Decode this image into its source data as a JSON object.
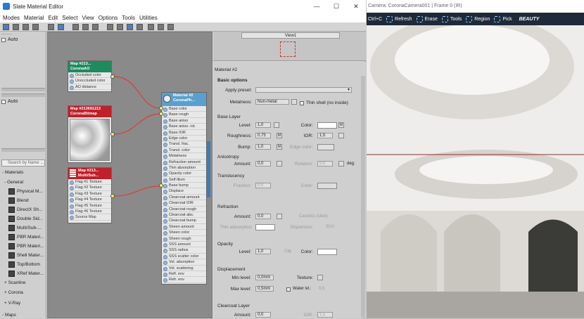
{
  "editor": {
    "title": "Slate Material Editor",
    "window_controls": [
      "—",
      "☐",
      "✕"
    ],
    "menu": [
      "Modes",
      "Material",
      "Edit",
      "Select",
      "View",
      "Options",
      "Tools",
      "Utilities"
    ]
  },
  "left_panel": {
    "auto_label_1": "Auto",
    "auto_label_2": "Auto",
    "search_placeholder": "Search by Name ...",
    "materials_header": "- Materials",
    "general_header": "- General",
    "materials": [
      "Physical M...",
      "Blend",
      "DirectX Sh...",
      "Double Sid...",
      "Multi/Sub-...",
      "PBR Materi...",
      "PBR Materi...",
      "Shell Mater...",
      "Top/Bottom",
      "XRef Mater..."
    ],
    "scanline": "+ Scanline",
    "corona": "+ Corona",
    "vray": "+ V-Ray",
    "maps": "- Maps"
  },
  "view": {
    "tab": "View1",
    "node_ao": {
      "title": "Map #213...",
      "subtitle": "CoronaAO",
      "rows": [
        "Occluded color",
        "Unoccluded color",
        "AO distance"
      ]
    },
    "node_bitmap": {
      "title": "Map #213691213",
      "subtitle": "CoronaBitmap"
    },
    "node_multi": {
      "title": "Map #213...",
      "subtitle": "Multi/Sub...",
      "rows": [
        "Flag #1 Texture",
        "Flag #2 Texture",
        "Flag #3 Texture",
        "Flag #4 Texture",
        "Flag #5 Texture",
        "Flag #6 Texture",
        "Source Map"
      ]
    },
    "node_material": {
      "title": "Material #2",
      "subtitle": "CoronaPh...",
      "rows": [
        "Base color",
        "Base rough",
        "Base aniso",
        "Base aniso. rot.",
        "Base IOR",
        "Edge color",
        "Transl. frac.",
        "Transl. color",
        "Metalness",
        "Refraction amount",
        "Thin absorption",
        "Opacity color",
        "Self-Illum",
        "Base bump",
        "Displace",
        "Clearcoat amount",
        "Clearcoat IOR",
        "Clearcoat rough",
        "Clearcoat abs.",
        "Clearcoat bump",
        "Sheen amount",
        "Sheen color",
        "Sheen rough",
        "SSS amount",
        "SSS radius",
        "SSS scatter color",
        "Vol. absorption",
        "Vol. scattering",
        "Refl. env",
        "Refr. env"
      ]
    }
  },
  "params": {
    "header": "Material #2",
    "basic_options": "Basic options",
    "apply_preset": "Apply preset:",
    "metalness_label": "Metalness:",
    "metalness_value": "Non-metal",
    "thin_shell": "Thin shell (no inside)",
    "base_layer": "Base Layer",
    "level_label": "Level:",
    "level_value": "1,0",
    "color_label": "Color:",
    "roughness_label": "Roughness:",
    "roughness_value": "0,75",
    "ior_label": "IOR:",
    "ior_value": "1,5",
    "bump_label": "Bump:",
    "bump_value": "1,0",
    "edge_color": "Edge color:",
    "anisotropy": "Anisotropy",
    "amount_label": "Amount:",
    "aniso_amount": "0,0",
    "rotation_label": "Rotation:",
    "rotation_value": "0,0",
    "deg": "deg.",
    "translucency": "Translucency",
    "fraction_label": "Fraction:",
    "fraction_value": "0,0",
    "refraction": "Refraction",
    "refr_amount": "0,0",
    "caustics": "Caustics (slow)",
    "thin_absorption": "Thin absorption:",
    "dispersion": "Dispersion:",
    "dispersion_value": "20,0",
    "opacity": "Opacity",
    "opacity_level": "1,0",
    "clip": "Clip",
    "displacement": "Displacement",
    "min_level_label": "Min level:",
    "min_level": "0,0mm",
    "texture_label": "Texture:",
    "max_level_label": "Max level:",
    "max_level": "0,5mm",
    "water_lvl": "Water lvl.:",
    "water_value": "0,5",
    "clearcoat": "Clearcoat Layer",
    "cc_amount": "0,0",
    "cc_ior": "1,5",
    "m": "M"
  },
  "render": {
    "title": "Camera: CoronaCamera001 | Frame 0 (IR)",
    "tools": [
      "Ctrl+C",
      "Refresh",
      "Erase",
      "Tools",
      "Region",
      "Pick"
    ],
    "beauty": "BEAUTY"
  }
}
